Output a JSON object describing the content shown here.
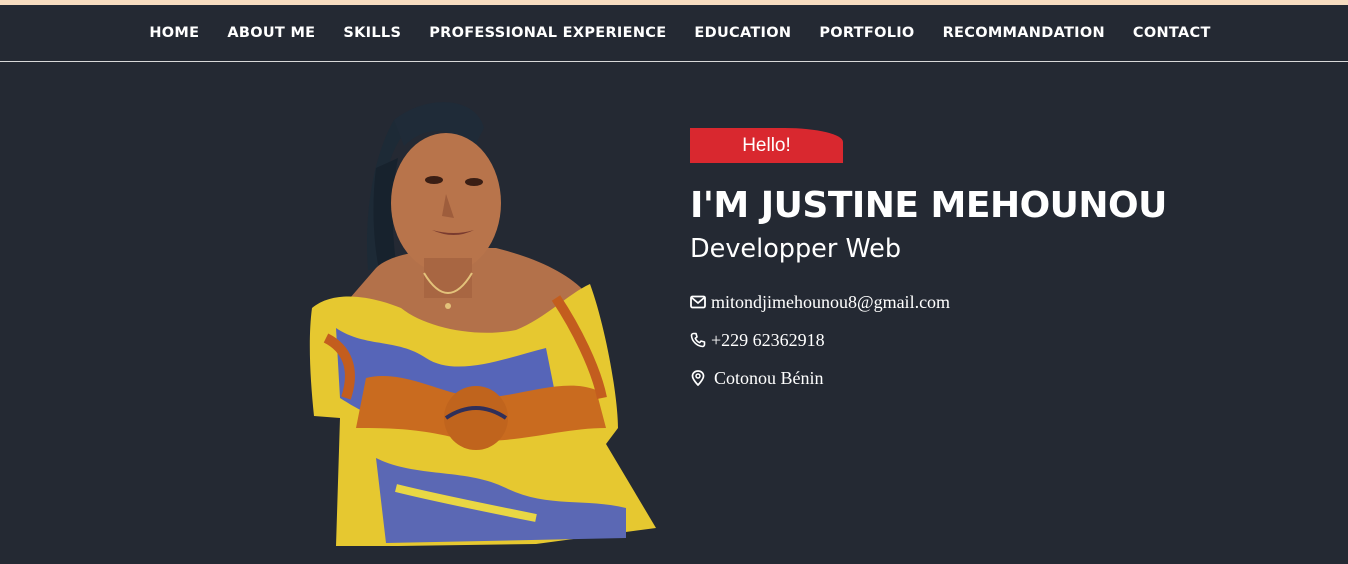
{
  "nav": {
    "items": [
      {
        "label": "HOME"
      },
      {
        "label": "ABOUT ME"
      },
      {
        "label": "SKILLS"
      },
      {
        "label": "PROFESSIONAL EXPERIENCE"
      },
      {
        "label": "EDUCATION"
      },
      {
        "label": "PORTFOLIO"
      },
      {
        "label": "RECOMMANDATION"
      },
      {
        "label": "CONTACT"
      }
    ]
  },
  "hero": {
    "badge": "Hello!",
    "name": "I'M JUSTINE MEHOUNOU",
    "role": "Developper Web",
    "contacts": {
      "email": {
        "icon": "envelope-icon",
        "value": "mitondjimehounou8@gmail.com"
      },
      "phone": {
        "icon": "phone-icon",
        "value": "+229 62362918"
      },
      "location": {
        "icon": "map-pin-icon",
        "value": "Cotonou Bénin"
      }
    }
  },
  "colors": {
    "background": "#242933",
    "top_strip": "#f6dcc0",
    "badge": "#d9282f",
    "text": "#ffffff"
  }
}
